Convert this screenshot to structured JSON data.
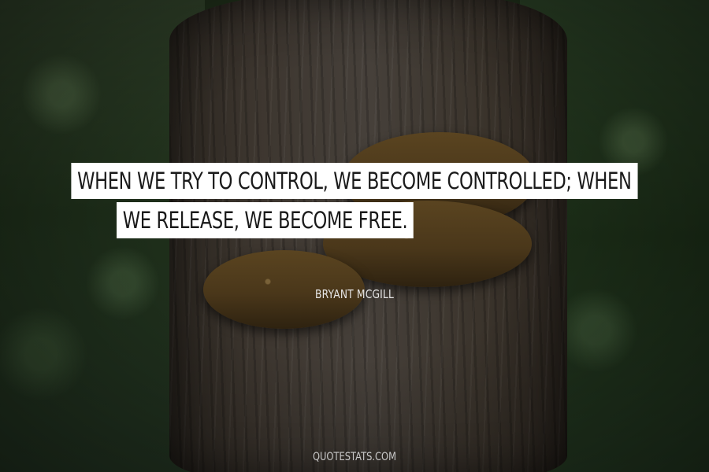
{
  "quote": {
    "line1": "WHEN WE TRY TO CONTROL, WE BECOME CONTROLLED; WHEN",
    "line2": "WE RELEASE, WE BECOME FREE."
  },
  "author": "BRYANT MCGILL",
  "credit": "QUOTESTATS.COM"
}
